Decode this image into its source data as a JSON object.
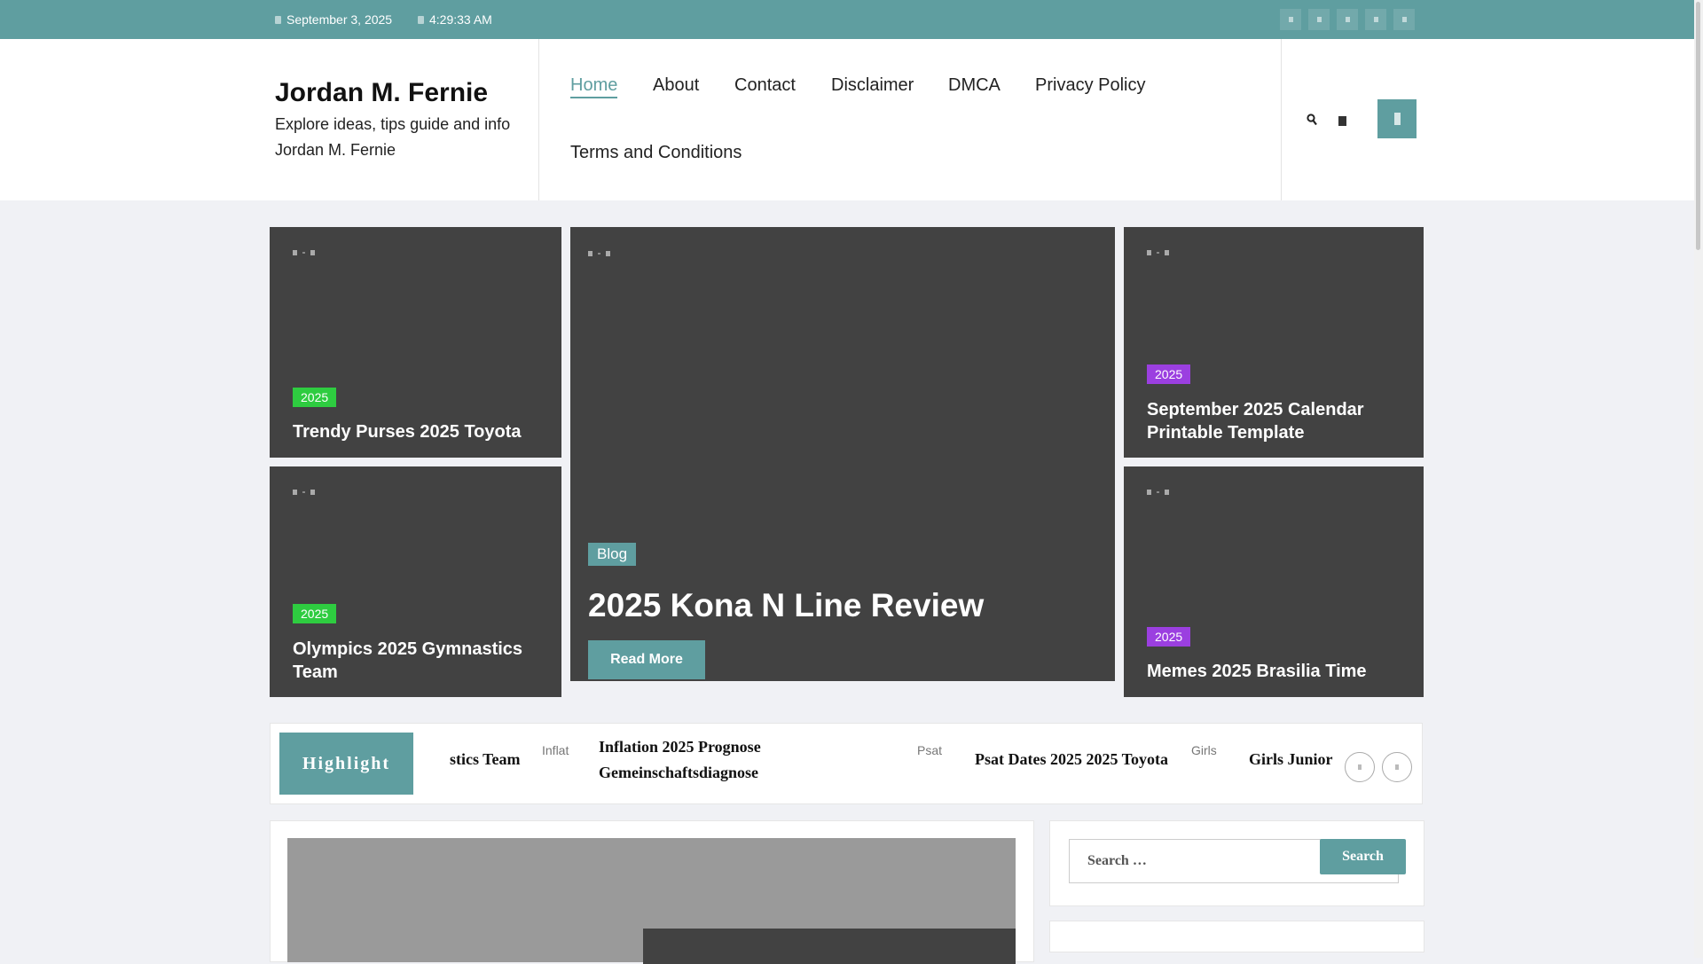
{
  "topbar": {
    "date": "September 3, 2025",
    "time": "4:29:33 AM",
    "social_icons": [
      "facebook-icon",
      "twitter-icon",
      "instagram-icon",
      "youtube-icon",
      "linkedin-icon"
    ]
  },
  "site": {
    "title": "Jordan M. Fernie",
    "tagline": "Explore ideas, tips guide and info Jordan M. Fernie"
  },
  "nav": {
    "items": [
      "Home",
      "About",
      "Contact",
      "Disclaimer",
      "DMCA",
      "Privacy Policy",
      "Terms and Conditions"
    ],
    "active": "Home"
  },
  "featured": {
    "left_top": {
      "category": "2025",
      "title": "Trendy Purses 2025 Toyota"
    },
    "left_bottom": {
      "category": "2025",
      "title": "Olympics 2025 Gymnastics Team"
    },
    "center": {
      "category": "Blog",
      "title": "2025 Kona N Line Review",
      "button": "Read More"
    },
    "right_top": {
      "category": "2025",
      "title": "September 2025 Calendar Printable Template"
    },
    "right_bottom": {
      "category": "2025",
      "title": "Memes 2025 Brasilia Time"
    }
  },
  "highlight": {
    "label": "Highlight",
    "items": [
      {
        "image_alt": "",
        "title": "stics Team"
      },
      {
        "image_alt": "Inflat",
        "title": "Inflation 2025 Prognose Gemeinschaftsdiagnose"
      },
      {
        "image_alt": "Psat",
        "title": "Psat Dates 2025 2025 Toyota"
      },
      {
        "image_alt": "Girls",
        "title": "Girls Junior"
      }
    ]
  },
  "sidebar": {
    "search_placeholder": "Search …",
    "search_button": "Search"
  },
  "colors": {
    "accent": "#5f9ea0",
    "card_bg": "#424242",
    "badge_green": "#2ecc40",
    "badge_purple": "#9b3fe0"
  }
}
